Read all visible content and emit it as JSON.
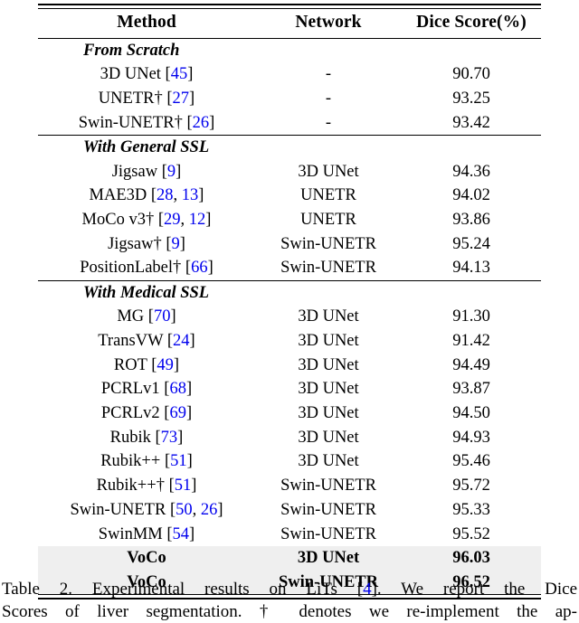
{
  "table": {
    "columns": [
      "Method",
      "Network",
      "Dice Score(%)"
    ],
    "ref_color": "#0000EE",
    "highlight_color": "#efefef",
    "sections": [
      {
        "title": "From Scratch",
        "rows": [
          {
            "method_name": "3D UNet",
            "method_dagger": "",
            "method_refs": "[45]",
            "network": "-",
            "dice": "90.70",
            "highlight": false
          },
          {
            "method_name": "UNETR",
            "method_dagger": "†",
            "method_refs": "[27]",
            "network": "-",
            "dice": "93.25",
            "highlight": false
          },
          {
            "method_name": "Swin-UNETR",
            "method_dagger": "†",
            "method_refs": "[26]",
            "network": "-",
            "dice": "93.42",
            "highlight": false
          }
        ]
      },
      {
        "title": "With General SSL",
        "rows": [
          {
            "method_name": "Jigsaw",
            "method_dagger": "",
            "method_refs": "[9]",
            "network": "3D UNet",
            "dice": "94.36",
            "highlight": false
          },
          {
            "method_name": "MAE3D",
            "method_dagger": "",
            "method_refs": "[28, 13]",
            "network": "UNETR",
            "dice": "94.02",
            "highlight": false
          },
          {
            "method_name": "MoCo v3",
            "method_dagger": "†",
            "method_refs": "[29, 12]",
            "network": "UNETR",
            "dice": "93.86",
            "highlight": false
          },
          {
            "method_name": "Jigsaw",
            "method_dagger": "†",
            "method_refs": "[9]",
            "network": "Swin-UNETR",
            "dice": "95.24",
            "highlight": false
          },
          {
            "method_name": "PositionLabel",
            "method_dagger": "†",
            "method_refs": "[66]",
            "network": "Swin-UNETR",
            "dice": "94.13",
            "highlight": false
          }
        ]
      },
      {
        "title": "With Medical SSL",
        "rows": [
          {
            "method_name": "MG",
            "method_dagger": "",
            "method_refs": "[70]",
            "network": "3D UNet",
            "dice": "91.30",
            "highlight": false
          },
          {
            "method_name": "TransVW",
            "method_dagger": "",
            "method_refs": "[24]",
            "network": "3D UNet",
            "dice": "91.42",
            "highlight": false
          },
          {
            "method_name": "ROT",
            "method_dagger": "",
            "method_refs": "[49]",
            "network": "3D UNet",
            "dice": "94.49",
            "highlight": false
          },
          {
            "method_name": "PCRLv1",
            "method_dagger": "",
            "method_refs": "[68]",
            "network": "3D UNet",
            "dice": "93.87",
            "highlight": false
          },
          {
            "method_name": "PCRLv2",
            "method_dagger": "",
            "method_refs": "[69]",
            "network": "3D UNet",
            "dice": "94.50",
            "highlight": false
          },
          {
            "method_name": "Rubik",
            "method_dagger": "",
            "method_refs": "[73]",
            "network": "3D UNet",
            "dice": "94.93",
            "highlight": false
          },
          {
            "method_name": "Rubik++",
            "method_dagger": "",
            "method_refs": "[51]",
            "network": "3D UNet",
            "dice": "95.46",
            "highlight": false
          },
          {
            "method_name": "Rubik++",
            "method_dagger": "†",
            "method_refs": "[51]",
            "network": "Swin-UNETR",
            "dice": "95.72",
            "highlight": false
          },
          {
            "method_name": "Swin-UNETR",
            "method_dagger": "",
            "method_refs": "[50, 26]",
            "network": "Swin-UNETR",
            "dice": "95.33",
            "highlight": false
          },
          {
            "method_name": "SwinMM",
            "method_dagger": "",
            "method_refs": "[54]",
            "network": "Swin-UNETR",
            "dice": "95.52",
            "highlight": false
          },
          {
            "method_name": "VoCo",
            "method_dagger": "",
            "method_refs": "",
            "network": "3D UNet",
            "dice": "96.03",
            "highlight": true
          },
          {
            "method_name": "VoCo",
            "method_dagger": "",
            "method_refs": "",
            "network": "Swin-UNETR",
            "dice": "96.52",
            "highlight": true
          }
        ]
      }
    ]
  },
  "caption": {
    "line1_pre": "Table 2. Experimental results on LiTs ",
    "line1_ref": "[4]",
    "line1_post": ". We report the Dice",
    "line2": "Scores of liver segmentation. † denotes we re-implement the ap-"
  }
}
